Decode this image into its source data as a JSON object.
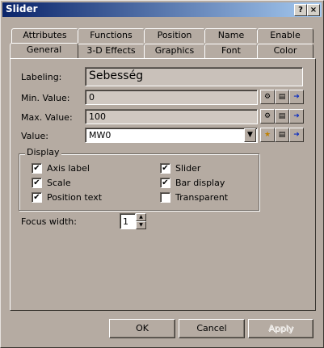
{
  "window": {
    "title": "Slider",
    "help_btn": "?",
    "close_btn": "×"
  },
  "tabs_row1": [
    "Attributes",
    "Functions",
    "Position",
    "Name",
    "Enable"
  ],
  "tabs_row2": [
    "General",
    "3-D Effects",
    "Graphics",
    "Font",
    "Color"
  ],
  "active_tab": "General",
  "general": {
    "labeling_label": "Labeling:",
    "labeling_value": "Sebesség",
    "min_label": "Min. Value:",
    "min_value": "0",
    "max_label": "Max. Value:",
    "max_value": "100",
    "value_label": "Value:",
    "value_value": "MW0"
  },
  "display": {
    "title": "Display",
    "options": [
      {
        "label": "Axis label",
        "checked": true
      },
      {
        "label": "Scale",
        "checked": true
      },
      {
        "label": "Position text",
        "checked": true
      },
      {
        "label": "Slider",
        "checked": true
      },
      {
        "label": "Bar display",
        "checked": true
      },
      {
        "label": "Transparent",
        "checked": false
      }
    ]
  },
  "focus": {
    "label": "Focus width:",
    "value": "1"
  },
  "buttons": {
    "ok": "OK",
    "cancel": "Cancel",
    "apply": "Apply"
  }
}
